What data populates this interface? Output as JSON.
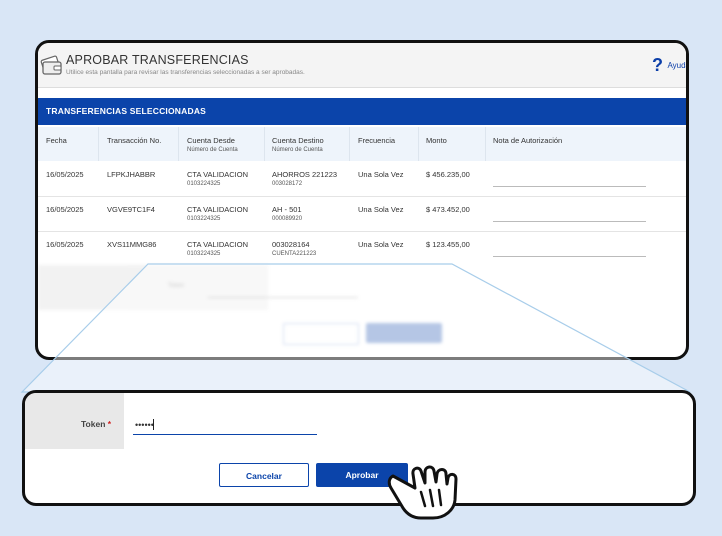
{
  "header": {
    "title": "APROBAR TRANSFERENCIAS",
    "subtitle": "Utilice esta pantalla para revisar las transferencias seleccionadas a ser aprobadas.",
    "help_label": "Ayuda",
    "help_symbol": "?"
  },
  "section": {
    "title": "TRANSFERENCIAS SELECCIONADAS"
  },
  "columns": {
    "fecha": "Fecha",
    "transaccion": "Transacción No.",
    "cuenta_desde": "Cuenta Desde",
    "cuenta_desde_sub": "Número de Cuenta",
    "cuenta_destino": "Cuenta Destino",
    "cuenta_destino_sub": "Número de Cuenta",
    "frecuencia": "Frecuencia",
    "monto": "Monto",
    "nota": "Nota de Autorización"
  },
  "rows": [
    {
      "fecha": "16/05/2025",
      "transaccion": "LFPKJHABBR",
      "desde": "CTA VALIDACION",
      "desde_num": "0103224325",
      "destino": "AHORROS 221223",
      "destino_num": "003028172",
      "frecuencia": "Una Sola Vez",
      "monto": "$ 456.235,00"
    },
    {
      "fecha": "16/05/2025",
      "transaccion": "VGVE9TC1F4",
      "desde": "CTA VALIDACION",
      "desde_num": "0103224325",
      "destino": "AH - 501",
      "destino_num": "000089920",
      "frecuencia": "Una Sola Vez",
      "monto": "$ 473.452,00"
    },
    {
      "fecha": "16/05/2025",
      "transaccion": "XVS11MMG86",
      "desde": "CTA VALIDACION",
      "desde_num": "0103224325",
      "destino": "003028164",
      "destino_num": "CUENTA221223",
      "frecuencia": "Una Sola Vez",
      "monto": "$ 123.455,00"
    }
  ],
  "token": {
    "label": "Token",
    "required_mark": "*",
    "value": "••••••"
  },
  "actions": {
    "cancel_label": "Cancelar",
    "approve_label": "Aprobar"
  },
  "colors": {
    "brand": "#0b44aa",
    "background": "#d9e6f6",
    "required": "#d21f1f"
  }
}
